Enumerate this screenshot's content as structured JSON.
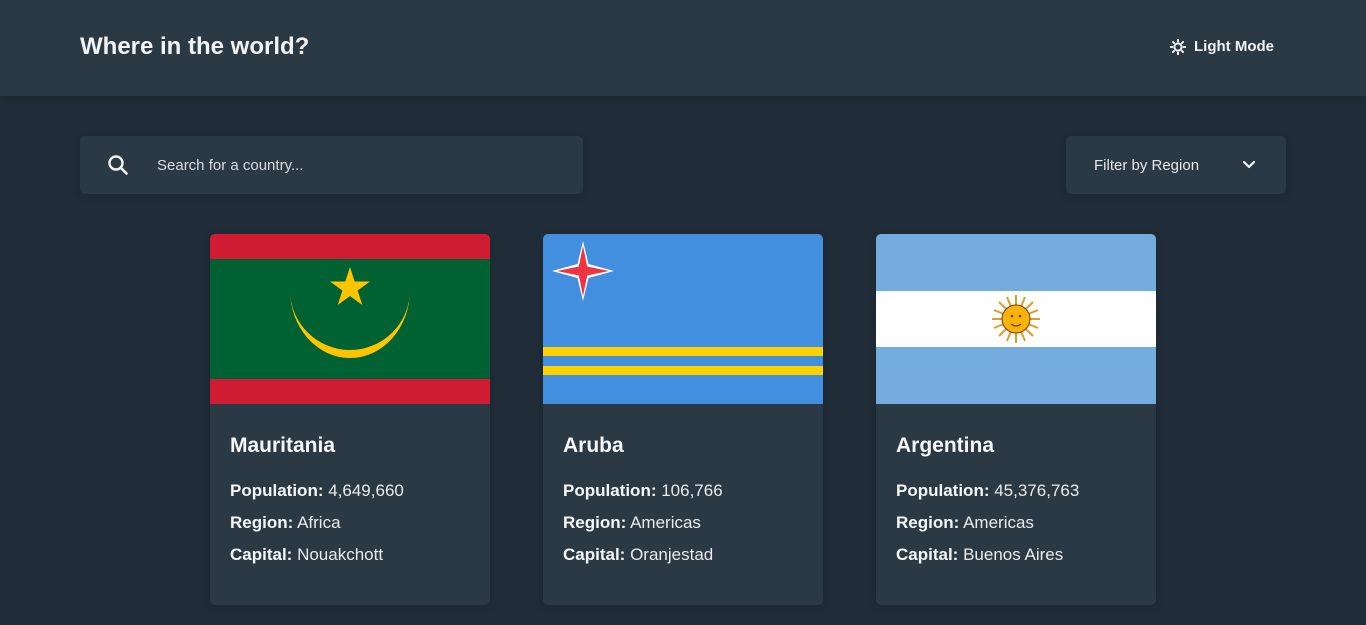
{
  "header": {
    "title": "Where in the world?",
    "theme_toggle_label": "Light Mode",
    "theme_icon": "sun-icon"
  },
  "search": {
    "placeholder": "Search for a country...",
    "value": "",
    "icon": "search-icon"
  },
  "filter": {
    "label": "Filter by Region",
    "icon": "chevron-down-icon"
  },
  "labels": {
    "population": "Population:",
    "region": "Region:",
    "capital": "Capital:"
  },
  "countries": [
    {
      "name": "Mauritania",
      "population": "4,649,660",
      "region": "Africa",
      "capital": "Nouakchott"
    },
    {
      "name": "Aruba",
      "population": "106,766",
      "region": "Americas",
      "capital": "Oranjestad"
    },
    {
      "name": "Argentina",
      "population": "45,376,763",
      "region": "Americas",
      "capital": "Buenos Aires"
    }
  ],
  "colors": {
    "background": "#202c37",
    "element": "#2b3945",
    "text": "#ffffff"
  }
}
